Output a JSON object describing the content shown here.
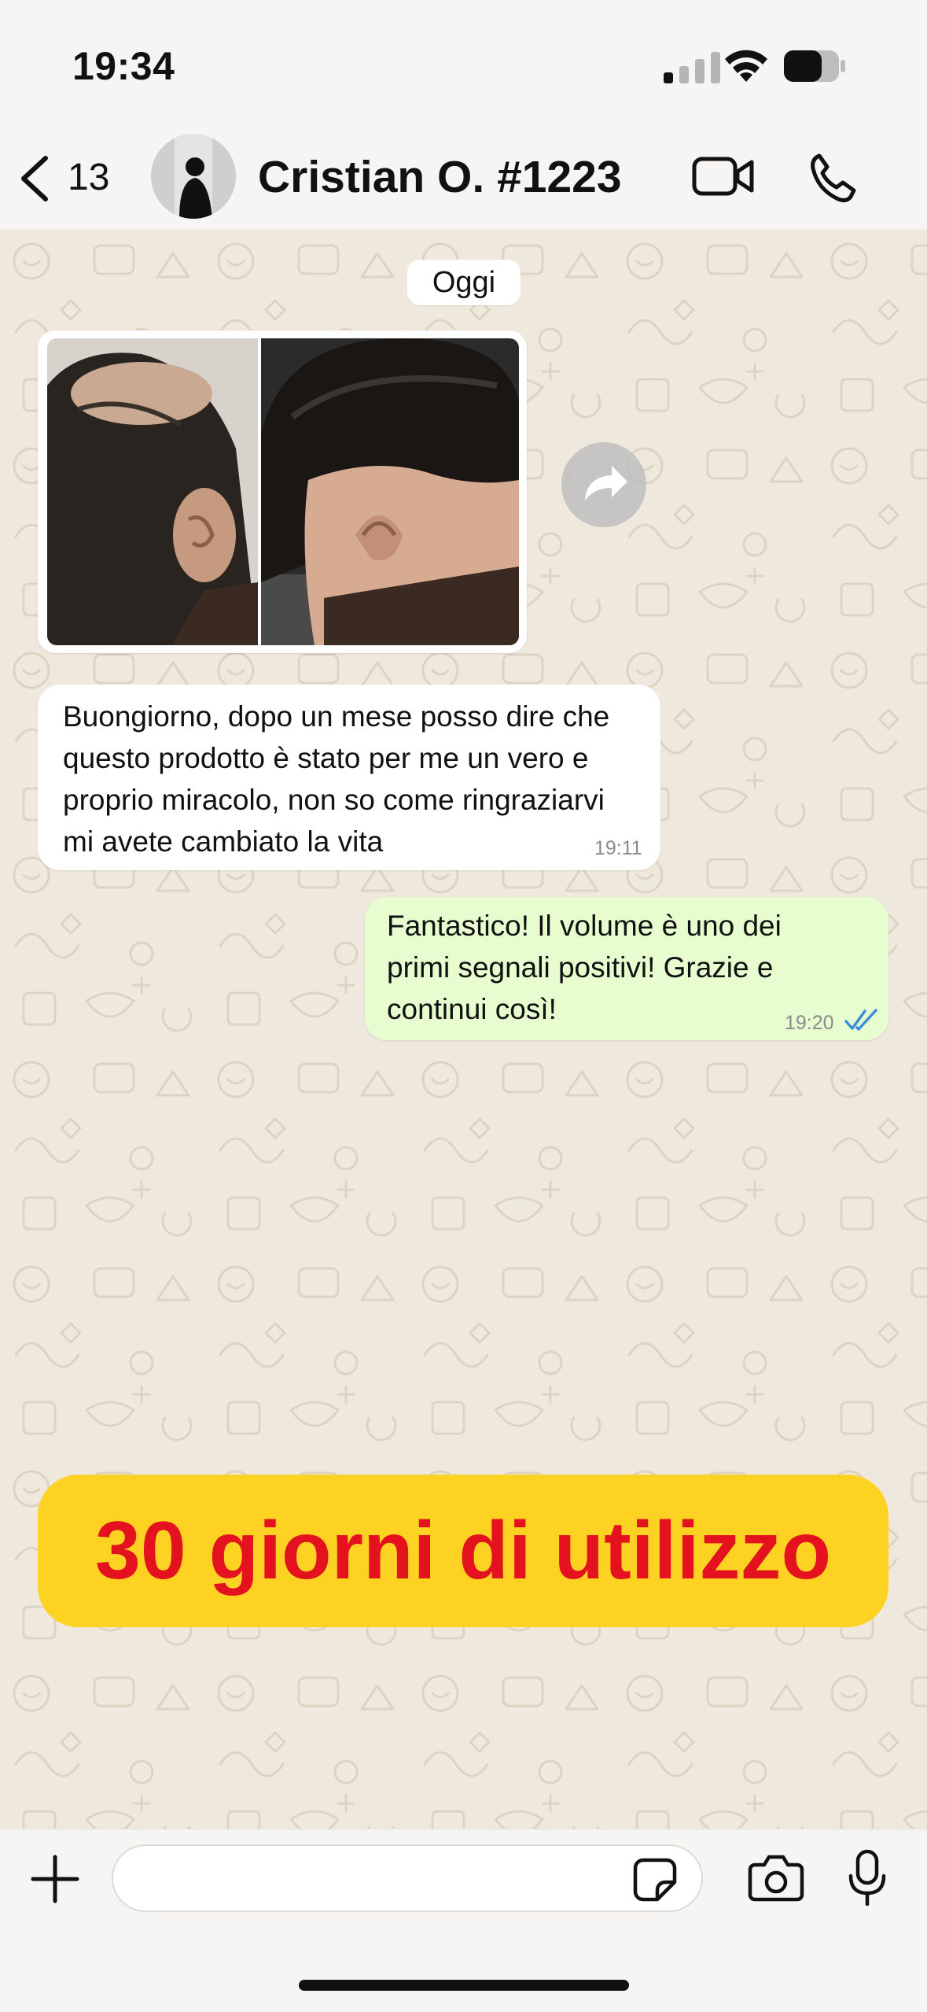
{
  "status_bar": {
    "time": "19:34",
    "icons": [
      "cellular-signal-icon",
      "wifi-icon",
      "battery-icon"
    ]
  },
  "header": {
    "back_count": "13",
    "contact_name": "Cristian O. #1223",
    "icons": [
      "chevron-left-icon",
      "video-camera-icon",
      "phone-icon"
    ]
  },
  "chat": {
    "date_label": "Oggi",
    "messages": [
      {
        "direction": "incoming",
        "type": "image",
        "description_icon": "before-after-photo"
      },
      {
        "direction": "incoming",
        "type": "text",
        "text": "Buongiorno, dopo un mese posso dire che questo prodotto è stato per me un vero e proprio miracolo, non so come ringraziarvi mi avete cambiato la vita",
        "time": "19:11"
      },
      {
        "direction": "outgoing",
        "type": "text",
        "text": "Fantastico! Il volume è uno dei primi segnali positivi! Grazie e continui così!",
        "time": "19:20",
        "status_icon": "double-check-read-icon"
      }
    ]
  },
  "banner": {
    "text": "30 giorni di utilizzo",
    "bg_color": "#fed223",
    "text_color": "#e4121f"
  },
  "composer": {
    "placeholder": "",
    "icons": [
      "plus-icon",
      "sticker-icon",
      "camera-icon",
      "microphone-icon"
    ]
  },
  "colors": {
    "outgoing_bubble": "#e7fccf",
    "incoming_bubble": "#ffffff",
    "read_ticks": "#3b8fd9",
    "wallpaper": "#efe9dd"
  }
}
